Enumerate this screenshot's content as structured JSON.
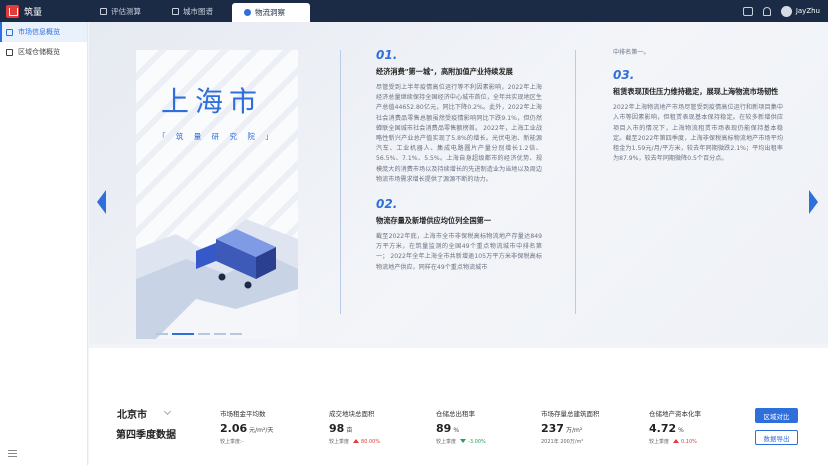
{
  "app": {
    "name": "筑量",
    "brand_color": "#e23b3b",
    "accent": "#2f6fdb"
  },
  "nav": {
    "tabs": [
      {
        "label": "评估测算",
        "icon": "calculator-icon"
      },
      {
        "label": "城市图谱",
        "icon": "map-icon"
      },
      {
        "label": "物流洞察",
        "icon": "globe-icon",
        "active": true
      }
    ]
  },
  "user": {
    "name": "JayZhu"
  },
  "sidebar": {
    "items": [
      {
        "label": "市场信息概览",
        "active": true
      },
      {
        "label": "区域仓储概览"
      }
    ]
  },
  "cover": {
    "title": "上海市",
    "subtitle": "「 筑 量 研 究 院 」"
  },
  "sections": [
    {
      "num": "01.",
      "title": "经济消费\"第一城\"，高附加值产业持续发展",
      "body": "尽管受到上半年疫情高位运行等不利因素影响，2022年上海经济总量继续保持全国经济中心城市首位，全年共实现地区生产总值44652.80亿元，同比下降0.2%。此外，2022年上海社会消费品零售总额虽然受疫情影响同比下跌9.1%，但仍然蝉联全国城市社会消费品零售额榜首。 2022年，上海工业战略性新兴产业总产值实现了5.8%的增长。光伏电池、新能源汽车、工业机器人、集成电路圆片产量分别增长1.2倍、56.5%、7.1%、5.5%。上海自身超级都市的经济优势、规模庞大的消费市场以及持续增长的先进制造业为当地以及周边物流市场需求增长提供了源源不断的动力。"
    },
    {
      "num": "02.",
      "title": "物流存量及新增供应均位列全国第一",
      "body": "截至2022年底，上海市全市非保税高标物流地产存量达849万平方米，在筑量监测的全国49个重点物流城市中排名第一； 2022年全年上海全市共新增逾105万平方米非保税高标物流地产供应，同样在49个重点物流城市"
    },
    {
      "lead": "中排名第一。",
      "num": "03.",
      "title": "租赁表现顶住压力维持稳定，展现上海物流市场韧性",
      "body": "2022年上海物流地产市场尽管受到疫情高位运行和新项目集中入市等因素影响，但租赁表现基本保持稳定。在较多新增供应项目入市的情况下，上海物流租赁市场表现仍能保持基本稳定。截至2022年第四季度，上海非保税高标物流地产市场平均租金为1.59元/月/平方米，较去年同期微跌2.1%；平均出租率为87.9%，较去年同期微降0.5个百分点。"
    }
  ],
  "stats": {
    "city": "北京市",
    "quarter": "第四季度数据",
    "metrics": [
      {
        "label": "市场租金平均数",
        "value": "2.06",
        "unit": "元/m²/天",
        "foot": "较上季度:-"
      },
      {
        "label": "成交地块总面积",
        "value": "98",
        "unit": "亩",
        "foot": "较上季度",
        "change": "80.00%",
        "dir": "up"
      },
      {
        "label": "仓储总出租率",
        "value": "89",
        "unit": "%",
        "foot": "较上季度",
        "change": "-3.00%",
        "dir": "down"
      },
      {
        "label": "市场存量总建筑面积",
        "value": "237",
        "unit": "万/m²",
        "foot": "2021年  200万/m²"
      },
      {
        "label": "仓储地产资本化率",
        "value": "4.72",
        "unit": "%",
        "foot": "较上季度",
        "change": "0.10%",
        "dir": "up"
      }
    ],
    "buttons": {
      "compare": "区域对比",
      "export": "数据导出"
    }
  }
}
